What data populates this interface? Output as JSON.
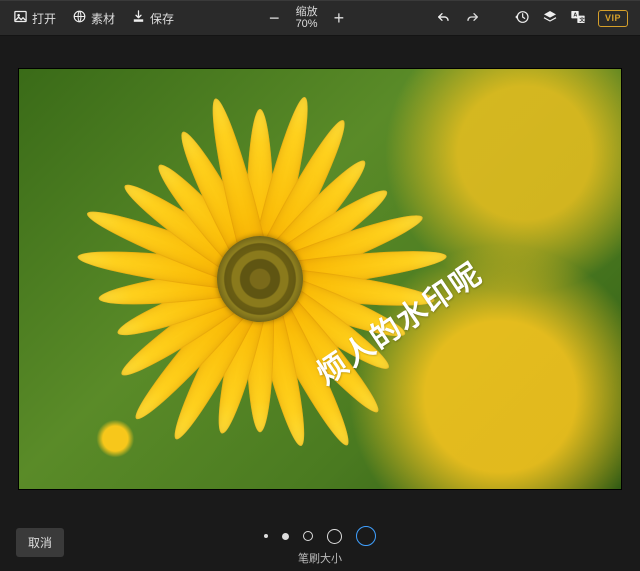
{
  "toolbar": {
    "open_label": "打开",
    "assets_label": "素材",
    "save_label": "保存",
    "zoom_label": "缩放",
    "zoom_value": "70%",
    "vip_label": "VIP"
  },
  "canvas": {
    "watermark_text": "烦人的水印呢"
  },
  "footer": {
    "cancel_label": "取消",
    "brush_label": "笔刷大小"
  }
}
